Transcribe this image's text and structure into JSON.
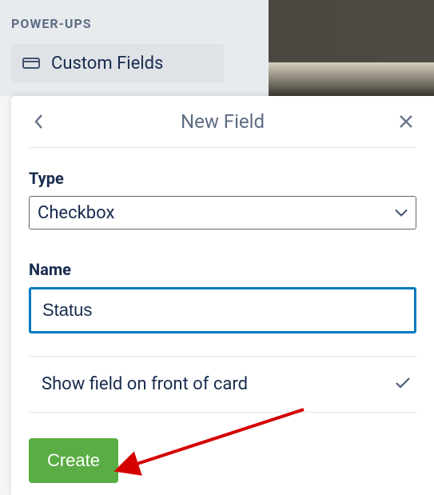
{
  "sidebar": {
    "heading": "POWER-UPS",
    "item_label": "Custom Fields"
  },
  "modal": {
    "title": "New Field",
    "type_label": "Type",
    "type_value": "Checkbox",
    "name_label": "Name",
    "name_value": "Status",
    "show_front_label": "Show field on front of card",
    "create_label": "Create"
  }
}
